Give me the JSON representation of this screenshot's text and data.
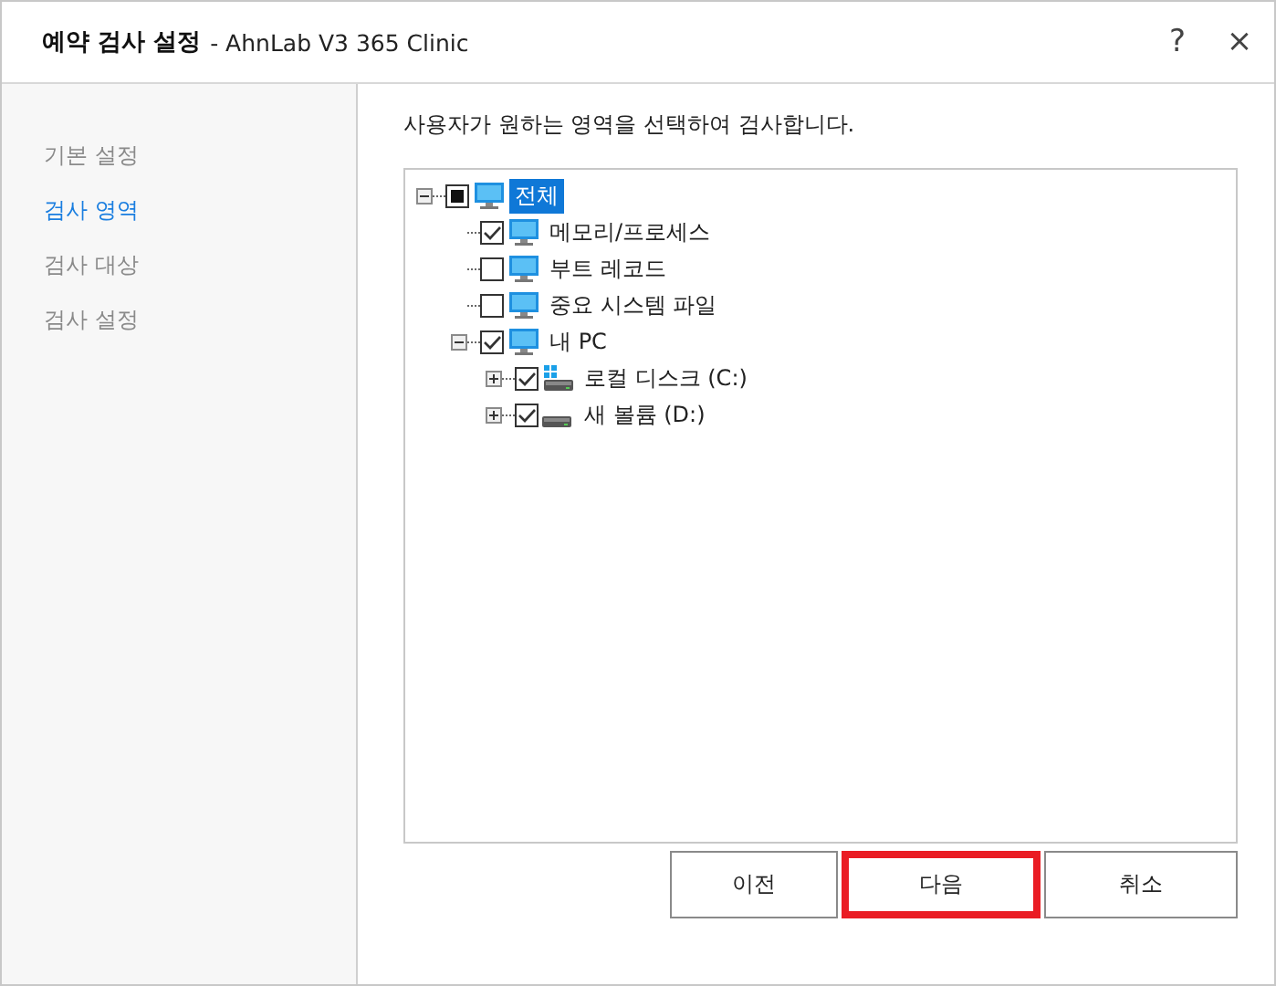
{
  "window": {
    "title": "예약 검사 설정",
    "subtitle": "- AhnLab V3 365 Clinic",
    "help": "?",
    "close": "×"
  },
  "sidebar": {
    "items": [
      {
        "label": "기본 설정",
        "selected": false
      },
      {
        "label": "검사 영역",
        "selected": true
      },
      {
        "label": "검사 대상",
        "selected": false
      },
      {
        "label": "검사 설정",
        "selected": false
      }
    ]
  },
  "description": "사용자가 원하는 영역을 선택하여 검사합니다.",
  "tree": [
    {
      "label": "전체",
      "kind": "monitor",
      "checked": true,
      "partial": true,
      "selected": true,
      "expanded": true,
      "children": [
        {
          "label": "메모리/프로세스",
          "kind": "monitor",
          "checked": true,
          "partial": false,
          "selected": false
        },
        {
          "label": "부트 레코드",
          "kind": "monitor",
          "checked": false,
          "partial": false,
          "selected": false
        },
        {
          "label": "중요 시스템 파일",
          "kind": "monitor",
          "checked": false,
          "partial": false,
          "selected": false
        },
        {
          "label": "내 PC",
          "kind": "monitor",
          "checked": true,
          "partial": false,
          "selected": false,
          "expanded": true,
          "children": [
            {
              "label": "로컬 디스크 (C:)",
              "kind": "systemdrive",
              "checked": true,
              "partial": false,
              "selected": false,
              "expanded": false
            },
            {
              "label": "새 볼륨 (D:)",
              "kind": "drive",
              "checked": true,
              "partial": false,
              "selected": false,
              "expanded": false
            }
          ]
        }
      ]
    }
  ],
  "buttons": [
    {
      "label": "이전",
      "highlighted": false
    },
    {
      "label": "다음",
      "highlighted": true
    },
    {
      "label": "취소",
      "highlighted": false
    }
  ]
}
